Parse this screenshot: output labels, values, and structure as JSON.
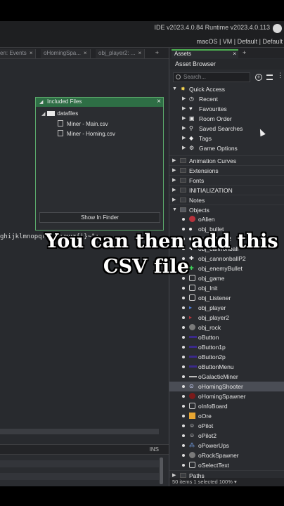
{
  "ide": {
    "version_text": "IDE v2023.4.0.84  Runtime v2023.4.0.113",
    "targets": "macOS | VM | Default | Default"
  },
  "editor": {
    "tabs": [
      {
        "label": "en: Events"
      },
      {
        "label": "oHomingSpa..."
      },
      {
        "label": "obj_player2: ..."
      }
    ],
    "add_tab": "+",
    "code_text": "ghijklmnopqrstuvwxyz{|}~\";",
    "status_ins": "INS"
  },
  "dialog": {
    "title": "Included Files",
    "root_folder": "datafiles",
    "files": [
      "Miner - Main.csv",
      "Miner - Homing.csv"
    ],
    "button": "Show In Finder"
  },
  "assets": {
    "tab_label": "Assets",
    "add_tab": "+",
    "title": "Asset Browser",
    "search_placeholder": "Search...",
    "quick_access": {
      "label": "Quick Access",
      "items": [
        "Recent",
        "Favourites",
        "Room Order",
        "Saved Searches",
        "Tags",
        "Game Options"
      ]
    },
    "groups": [
      "Animation Curves",
      "Extensions",
      "Fonts",
      "INITIALIZATION",
      "Notes"
    ],
    "objects_label": "Objects",
    "objects": [
      {
        "name": "oAlien",
        "icon": "red-alien-icon"
      },
      {
        "name": "obj_bullet",
        "icon": "bullet-icon"
      },
      {
        "name": "obj_bulletP2",
        "icon": "bullet-icon"
      },
      {
        "name": "obj_cannonball",
        "icon": "white-cross-icon"
      },
      {
        "name": "obj_cannonballP2",
        "icon": "white-cross-icon"
      },
      {
        "name": "obj_enemyBullet",
        "icon": "green-cross-icon"
      },
      {
        "name": "obj_game",
        "icon": "blank-object-icon"
      },
      {
        "name": "obj_Init",
        "icon": "blank-object-icon"
      },
      {
        "name": "obj_Listener",
        "icon": "blank-object-icon"
      },
      {
        "name": "obj_player",
        "icon": "blue-ship-icon"
      },
      {
        "name": "obj_player2",
        "icon": "red-ship-icon"
      },
      {
        "name": "obj_rock",
        "icon": "rock-icon"
      },
      {
        "name": "oButton",
        "icon": "button-bar-icon"
      },
      {
        "name": "oButton1p",
        "icon": "button-bar-icon"
      },
      {
        "name": "oButton2p",
        "icon": "button-bar-icon"
      },
      {
        "name": "oButtonMenu",
        "icon": "button-bar-icon"
      },
      {
        "name": "oGalacticMiner",
        "icon": "logo-icon"
      },
      {
        "name": "oHomingShooter",
        "icon": "homing-icon",
        "selected": true
      },
      {
        "name": "oHomingSpawner",
        "icon": "dark-red-icon"
      },
      {
        "name": "oInfoBoard",
        "icon": "blank-object-icon"
      },
      {
        "name": "oOre",
        "icon": "ore-icon"
      },
      {
        "name": "oPilot",
        "icon": "pilot-icon"
      },
      {
        "name": "oPilot2",
        "icon": "pilot-icon"
      },
      {
        "name": "oPowerUps",
        "icon": "powerups-icon"
      },
      {
        "name": "oRockSpawner",
        "icon": "rock-icon"
      },
      {
        "name": "oSelectText",
        "icon": "blank-object-icon"
      }
    ],
    "paths_label": "Paths",
    "footer": "50 items   1 selected  100% ▾"
  },
  "caption": {
    "line1": "You can then add this",
    "line2": "CSV file"
  }
}
